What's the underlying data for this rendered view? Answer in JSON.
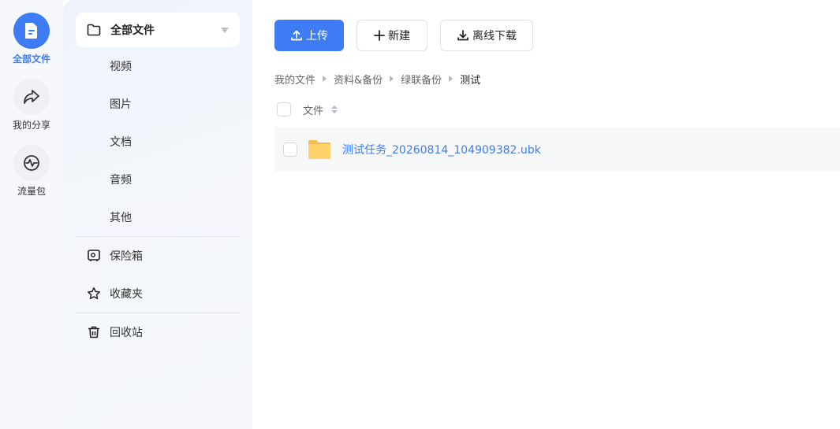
{
  "rail": {
    "items": [
      {
        "label": "全部文件",
        "icon": "file-icon",
        "active": true
      },
      {
        "label": "我的分享",
        "icon": "share-icon",
        "active": false
      },
      {
        "label": "流量包",
        "icon": "traffic-icon",
        "active": false
      }
    ]
  },
  "sidebar": {
    "head_label": "全部文件",
    "sub_items": [
      "视频",
      "图片",
      "文档",
      "音频",
      "其他"
    ],
    "items": [
      {
        "label": "保险箱",
        "icon": "safe-icon"
      },
      {
        "label": "收藏夹",
        "icon": "star-icon"
      },
      {
        "label": "回收站",
        "icon": "trash-icon"
      }
    ]
  },
  "toolbar": {
    "upload_label": "上传",
    "new_label": "新建",
    "offline_label": "离线下载"
  },
  "breadcrumb": [
    "我的文件",
    "资料&备份",
    "绿联备份",
    "测试"
  ],
  "list": {
    "header_label": "文件",
    "files": [
      {
        "name": "测试任务_20260814_104909382.ubk",
        "type": "folder"
      }
    ]
  },
  "colors": {
    "accent": "#3d7cf5",
    "folder": "#ffd36a"
  }
}
